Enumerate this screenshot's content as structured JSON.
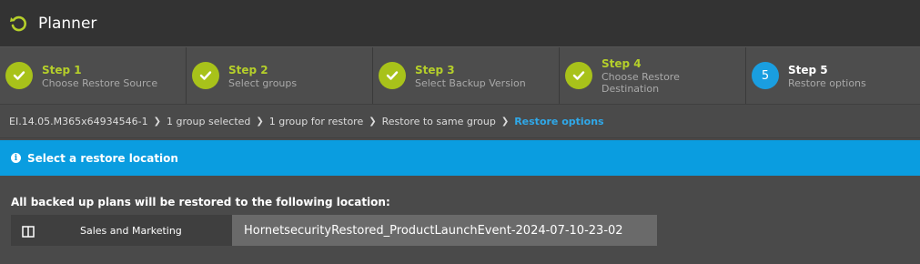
{
  "header": {
    "title": "Planner",
    "icon": "refresh-icon"
  },
  "steps": [
    {
      "num": "Step 1",
      "desc": "Choose Restore Source",
      "state": "done"
    },
    {
      "num": "Step 2",
      "desc": "Select groups",
      "state": "done"
    },
    {
      "num": "Step 3",
      "desc": "Select Backup Version",
      "state": "done"
    },
    {
      "num": "Step 4",
      "desc": "Choose Restore Destination",
      "state": "done"
    },
    {
      "num": "Step 5",
      "desc": "Restore options",
      "state": "active",
      "badge": "5"
    }
  ],
  "breadcrumb": {
    "items": [
      "EI.14.05.M365x64934546-1",
      "1 group selected",
      "1 group for restore",
      "Restore to same group"
    ],
    "current": "Restore options"
  },
  "info_bar": {
    "text": "Select a restore location"
  },
  "content": {
    "label": "All backed up plans will be restored to the following location:",
    "source_group": "Sales and Marketing",
    "target_location": "HornetsecurityRestored_ProductLaunchEvent-2024-07-10-23-02"
  },
  "colors": {
    "accent_green": "#a8c21a",
    "accent_blue": "#0a9de0",
    "link_blue": "#2fa9ea"
  }
}
